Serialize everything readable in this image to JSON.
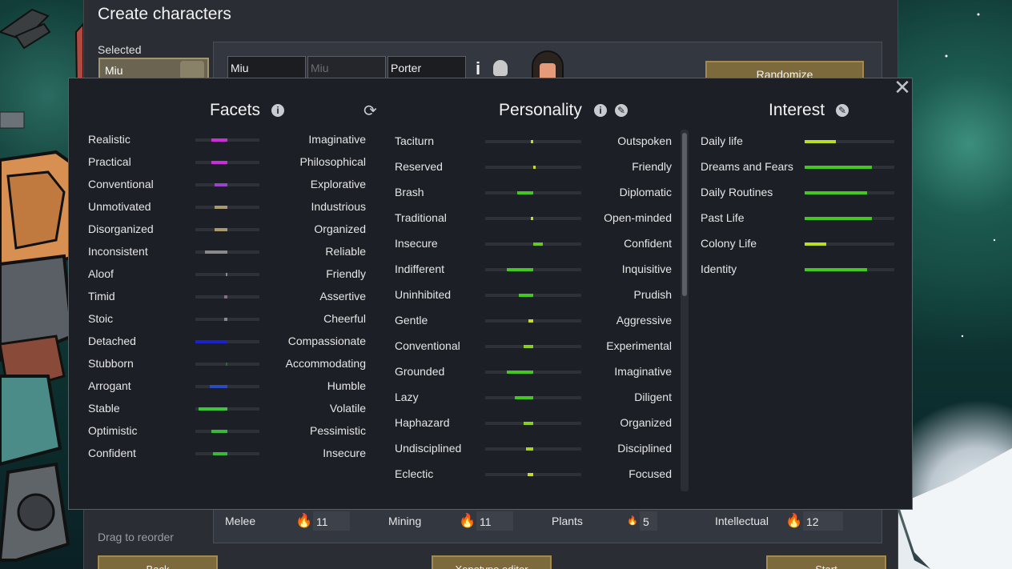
{
  "window": {
    "title": "Create characters"
  },
  "selected": {
    "label": "Selected",
    "pawn_name": "Miu"
  },
  "name_fields": {
    "first": "Miu",
    "nickname_placeholder": "Miu",
    "last": "Porter"
  },
  "buttons": {
    "randomize": "Randomize",
    "back": "Back",
    "xenotype_editor": "Xenotype editor",
    "start": "Start"
  },
  "drag_hint": "Drag to reorder",
  "skills": [
    {
      "name": "Melee",
      "value": "11",
      "passion": "major"
    },
    {
      "name": "Mining",
      "value": "11",
      "passion": "major"
    },
    {
      "name": "Plants",
      "value": "5",
      "passion": "minor"
    },
    {
      "name": "Intellectual",
      "value": "12",
      "passion": "major"
    }
  ],
  "dialog": {
    "facets_title": "Facets",
    "personality_title": "Personality",
    "interest_title": "Interest"
  },
  "facets": [
    {
      "left": "Realistic",
      "right": "Imaginative",
      "value": -0.5,
      "color": "#c92fd6"
    },
    {
      "left": "Practical",
      "right": "Philosophical",
      "value": -0.5,
      "color": "#c92fd6"
    },
    {
      "left": "Conventional",
      "right": "Explorative",
      "value": -0.4,
      "color": "#9a45c8"
    },
    {
      "left": "Unmotivated",
      "right": "Industrious",
      "value": -0.4,
      "color": "#a89a6e"
    },
    {
      "left": "Disorganized",
      "right": "Organized",
      "value": -0.4,
      "color": "#a89a6e"
    },
    {
      "left": "Inconsistent",
      "right": "Reliable",
      "value": -0.7,
      "color": "#8a8a8a"
    },
    {
      "left": "Aloof",
      "right": "Friendly",
      "value": -0.05,
      "color": "#8a8a8a"
    },
    {
      "left": "Timid",
      "right": "Assertive",
      "value": -0.1,
      "color": "#8b6a8a"
    },
    {
      "left": "Stoic",
      "right": "Cheerful",
      "value": -0.1,
      "color": "#8a8a8a"
    },
    {
      "left": "Detached",
      "right": "Compassionate",
      "value": -1.0,
      "color": "#1a22c8"
    },
    {
      "left": "Stubborn",
      "right": "Accommodating",
      "value": -0.02,
      "color": "#2a6a3a"
    },
    {
      "left": "Arrogant",
      "right": "Humble",
      "value": -0.55,
      "color": "#2a4ac0"
    },
    {
      "left": "Stable",
      "right": "Volatile",
      "value": -0.9,
      "color": "#3ac83a"
    },
    {
      "left": "Optimistic",
      "right": "Pessimistic",
      "value": -0.5,
      "color": "#3ab83a"
    },
    {
      "left": "Confident",
      "right": "Insecure",
      "value": -0.45,
      "color": "#3ab83a"
    }
  ],
  "personality": [
    {
      "left": "Taciturn",
      "right": "Outspoken",
      "value": -0.05,
      "color": "#c8d828"
    },
    {
      "left": "Reserved",
      "right": "Friendly",
      "value": 0.05,
      "color": "#c8d828"
    },
    {
      "left": "Brash",
      "right": "Diplomatic",
      "value": -0.33,
      "color": "#44c820"
    },
    {
      "left": "Traditional",
      "right": "Open-minded",
      "value": -0.05,
      "color": "#c8d828"
    },
    {
      "left": "Insecure",
      "right": "Confident",
      "value": 0.2,
      "color": "#66c820"
    },
    {
      "left": "Indifferent",
      "right": "Inquisitive",
      "value": -0.55,
      "color": "#44c820"
    },
    {
      "left": "Uninhibited",
      "right": "Prudish",
      "value": -0.3,
      "color": "#44c820"
    },
    {
      "left": "Gentle",
      "right": "Aggressive",
      "value": -0.1,
      "color": "#c8d828"
    },
    {
      "left": "Conventional",
      "right": "Experimental",
      "value": -0.2,
      "color": "#88d020"
    },
    {
      "left": "Grounded",
      "right": "Imaginative",
      "value": -0.55,
      "color": "#44c820"
    },
    {
      "left": "Lazy",
      "right": "Diligent",
      "value": -0.38,
      "color": "#44c820"
    },
    {
      "left": "Haphazard",
      "right": "Organized",
      "value": -0.2,
      "color": "#88d020"
    },
    {
      "left": "Undisciplined",
      "right": "Disciplined",
      "value": -0.15,
      "color": "#a8d420"
    },
    {
      "left": "Eclectic",
      "right": "Focused",
      "value": -0.12,
      "color": "#c8d828"
    }
  ],
  "interests": [
    {
      "name": "Daily life",
      "value": 0.35,
      "color": "#b8e020"
    },
    {
      "name": "Dreams and Fears",
      "value": 0.75,
      "color": "#44c820"
    },
    {
      "name": "Daily Routines",
      "value": 0.7,
      "color": "#44c820"
    },
    {
      "name": "Past Life",
      "value": 0.75,
      "color": "#44c820"
    },
    {
      "name": "Colony Life",
      "value": 0.24,
      "color": "#b8e020"
    },
    {
      "name": "Identity",
      "value": 0.7,
      "color": "#44c820"
    }
  ]
}
